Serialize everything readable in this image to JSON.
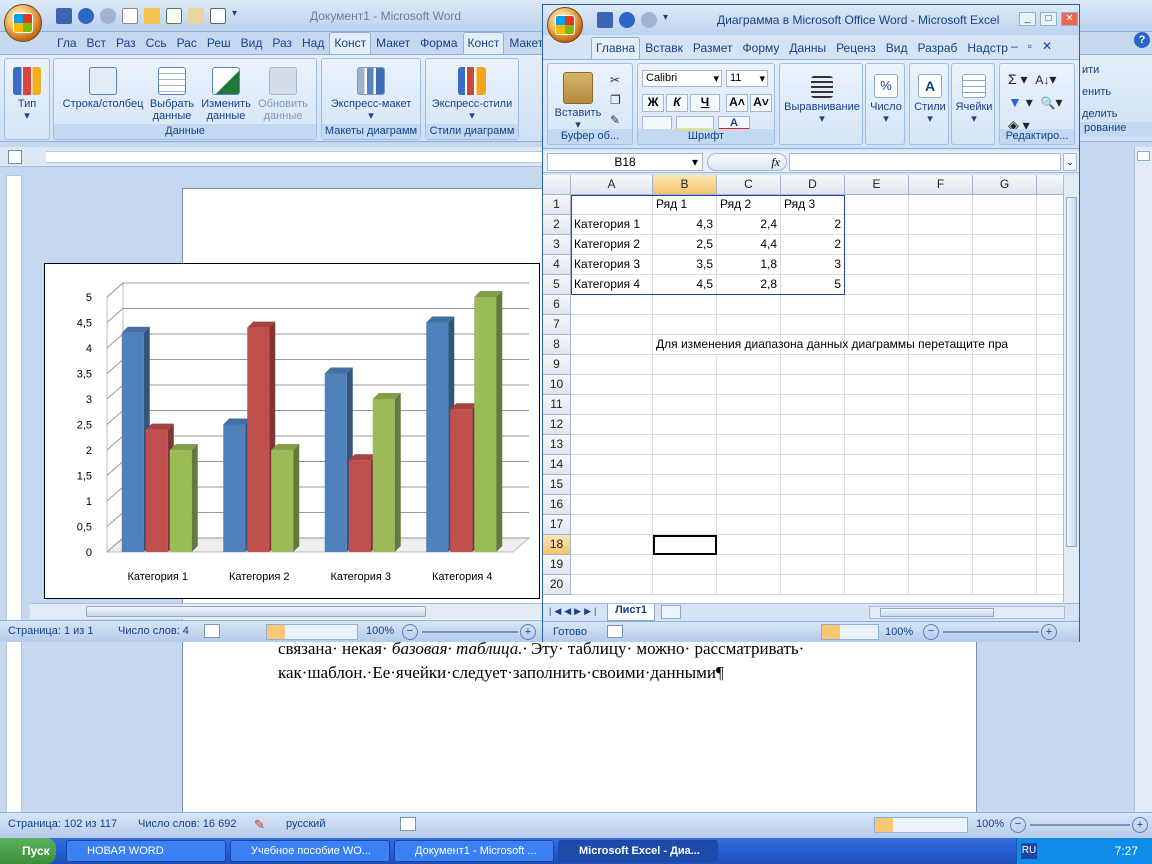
{
  "word": {
    "title": "Документ1 - Microsoft Word",
    "tabs": [
      "Гла",
      "Вст",
      "Раз",
      "Ссь",
      "Рас",
      "Реш",
      "Вид",
      "Раз",
      "Над",
      "Конст",
      "Макет",
      "Форма",
      "Конст",
      "Макет"
    ],
    "active_tab": "Конст",
    "ribbon_groups": [
      {
        "label": ""
      },
      {
        "label": "Данные"
      },
      {
        "label": "Макеты диаграмм"
      },
      {
        "label": "Стили диаграмм"
      }
    ],
    "buttons": {
      "type": "Тип",
      "row_col": "Строка/столбец",
      "select_data_1": "Выбрать",
      "select_data_2": "данные",
      "edit_data_1": "Изменить",
      "edit_data_2": "данные",
      "refresh_data_1": "Обновить",
      "refresh_data_2": "данные",
      "quick_layout": "Экспресс-макет",
      "quick_styles": "Экспресс-стили"
    },
    "right_partial": [
      "ити",
      "енить",
      "делить",
      "рование"
    ],
    "inner_status": {
      "page": "Страница: 1 из 1",
      "words": "Число слов: 4",
      "zoom": "100%"
    },
    "doc_text_line1_a": "связана· некая·",
    "doc_text_line1_b": "базовая· таблица.·",
    "doc_text_line1_c": "Эту· таблицу· можно· рассматривать·",
    "doc_text_line2": "как·шаблон.·Ее·ячейки·следует·заполнить·своими·данными¶",
    "status": {
      "page": "Страница: 102 из 117",
      "words": "Число слов: 16 692",
      "lang": "русский",
      "zoom": "100%"
    }
  },
  "chart_data": {
    "type": "bar",
    "categories": [
      "Категория 1",
      "Категория 2",
      "Категория 3",
      "Категория 4"
    ],
    "series": [
      {
        "name": "Ряд 1",
        "color": "#4f81bd",
        "values": [
          4.3,
          2.5,
          3.5,
          4.5
        ]
      },
      {
        "name": "Ряд 2",
        "color": "#c0504d",
        "values": [
          2.4,
          4.4,
          1.8,
          2.8
        ]
      },
      {
        "name": "Ряд 3",
        "color": "#9bbb59",
        "values": [
          2,
          2,
          3,
          5
        ]
      }
    ],
    "yticks": [
      "0",
      "0,5",
      "1",
      "1,5",
      "2",
      "2,5",
      "3",
      "3,5",
      "4",
      "4,5",
      "5"
    ],
    "ylim": [
      0,
      5
    ],
    "grid": true
  },
  "excel": {
    "title": "Диаграмма в Microsoft Office Word - Microsoft Excel",
    "tabs": [
      "Главна",
      "Вставк",
      "Размет",
      "Форму",
      "Данны",
      "Реценз",
      "Вид",
      "Разраб",
      "Надстр"
    ],
    "active_tab": "Главна",
    "font_name": "Calibri",
    "font_size": "11",
    "groups": [
      "Буфер об...",
      "Шрифт",
      "Редактиро..."
    ],
    "buttons": {
      "paste": "Вставить",
      "align": "Выравнивание",
      "number": "Число",
      "styles": "Стили",
      "cells": "Ячейки",
      "bold": "Ж",
      "italic": "К",
      "underline": "Ч",
      "percent": "%",
      "fx": "fx",
      "sigma": "Σ"
    },
    "name_box": "B18",
    "formula": "",
    "columns": [
      "A",
      "B",
      "C",
      "D",
      "E",
      "F",
      "G"
    ],
    "rows": [
      "1",
      "2",
      "3",
      "4",
      "5",
      "6",
      "7",
      "8",
      "9",
      "10",
      "11",
      "12",
      "13",
      "14",
      "15",
      "16",
      "17",
      "18",
      "19",
      "20"
    ],
    "cells": {
      "B1": "Ряд 1",
      "C1": "Ряд 2",
      "D1": "Ряд 3",
      "A2": "Категория 1",
      "B2": "4,3",
      "C2": "2,4",
      "D2": "2",
      "A3": "Категория 2",
      "B3": "2,5",
      "C3": "4,4",
      "D3": "2",
      "A4": "Категория 3",
      "B4": "3,5",
      "C4": "1,8",
      "D4": "3",
      "A5": "Категория 4",
      "B5": "4,5",
      "C5": "2,8",
      "D5": "5",
      "B8": "Для изменения диапазона данных диаграммы перетащите пра"
    },
    "sheet_tab": "Лист1",
    "status_ready": "Готово",
    "zoom": "100%"
  },
  "taskbar": {
    "start": "Пуск",
    "items": [
      {
        "label": "НОВАЯ WORD",
        "active": false
      },
      {
        "label": "Учебное пособие WO...",
        "active": false
      },
      {
        "label": "Документ1 - Microsoft ...",
        "active": false
      },
      {
        "label": "Microsoft Excel - Диа...",
        "active": true
      }
    ],
    "lang": "RU",
    "time": "7:27"
  }
}
